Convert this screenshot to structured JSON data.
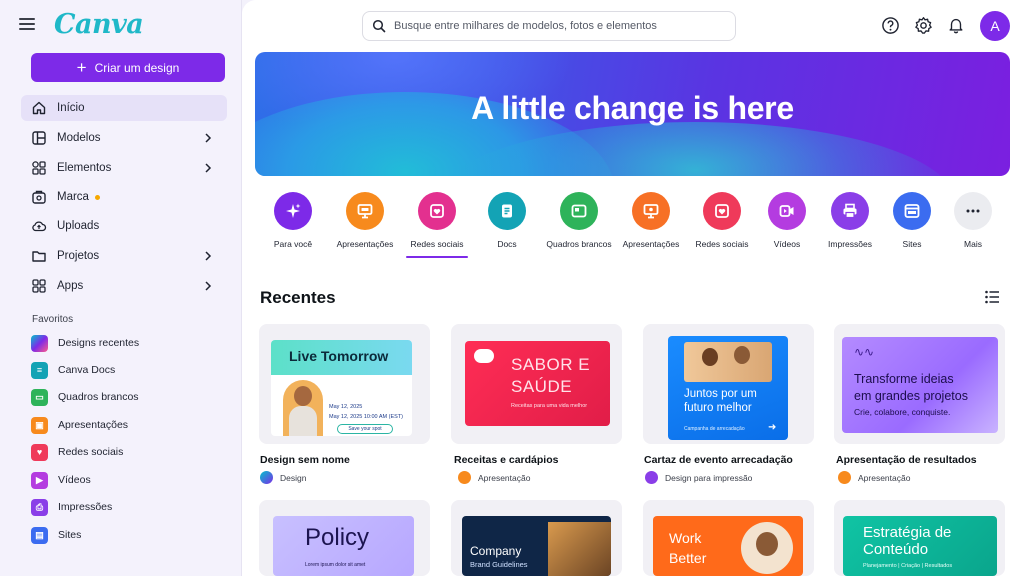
{
  "app": {
    "logo": "Canva"
  },
  "sidebar": {
    "create_label": "Criar um design",
    "nav": [
      {
        "label": "Início"
      },
      {
        "label": "Modelos"
      },
      {
        "label": "Elementos"
      },
      {
        "label": "Marca"
      },
      {
        "label": "Uploads"
      },
      {
        "label": "Projetos"
      },
      {
        "label": "Apps"
      }
    ],
    "favorites_title": "Favoritos",
    "favorites": [
      {
        "label": "Designs recentes"
      },
      {
        "label": "Canva Docs"
      },
      {
        "label": "Quadros brancos"
      },
      {
        "label": "Apresentações"
      },
      {
        "label": "Redes sociais"
      },
      {
        "label": "Vídeos"
      },
      {
        "label": "Impressões"
      },
      {
        "label": "Sites"
      }
    ]
  },
  "header": {
    "search_placeholder": "Busque entre milhares de modelos, fotos e elementos",
    "avatar_initial": "A"
  },
  "banner": {
    "title": "A little change is here"
  },
  "categories": [
    {
      "label": "Para você"
    },
    {
      "label": "Apresentações"
    },
    {
      "label": "Redes sociais"
    },
    {
      "label": "Docs"
    },
    {
      "label": "Quadros brancos"
    },
    {
      "label": "Apresentações"
    },
    {
      "label": "Redes sociais"
    },
    {
      "label": "Vídeos"
    },
    {
      "label": "Impressões"
    },
    {
      "label": "Sites"
    },
    {
      "label": "Mais"
    }
  ],
  "recent": {
    "title": "Recentes",
    "cards": [
      {
        "name": "Design sem nome",
        "type": "Design",
        "thumb": {
          "title": "Live Tomorrow",
          "line1": "May 12, 2025",
          "line2": "May 12, 2025 10:00 AM (EST)",
          "button": "Save your spot"
        }
      },
      {
        "name": "Receitas e cardápios",
        "type": "Apresentação",
        "thumb": {
          "title1": "SABOR E",
          "title2": "SAÚDE",
          "sub": "Receitas para uma vida melhor"
        }
      },
      {
        "name": "Cartaz de evento arrecadação",
        "type": "Design para impressão",
        "thumb": {
          "title1": "Juntos por um",
          "title2": "futuro melhor",
          "sub": "Campanha de arrecadação"
        }
      },
      {
        "name": "Apresentação de resultados",
        "type": "Apresentação",
        "thumb": {
          "title1": "Transforme ideias",
          "title2": "em grandes projetos",
          "sub": "Crie, colabore, conquiste."
        }
      },
      {
        "thumb": {
          "title": "Policy",
          "sub": "Lorem ipsum dolor sit amet"
        }
      },
      {
        "thumb": {
          "title1": "Company",
          "title2": "Brand Guidelines"
        }
      },
      {
        "thumb": {
          "title1": "Work",
          "title2": "Better"
        }
      },
      {
        "thumb": {
          "title1": "Estratégia de",
          "title2": "Conteúdo",
          "sub": "Planejamento | Criação | Resultados"
        }
      }
    ]
  },
  "colors": {
    "brand": "#7d2ae8",
    "logo": "#1fb8c8"
  }
}
